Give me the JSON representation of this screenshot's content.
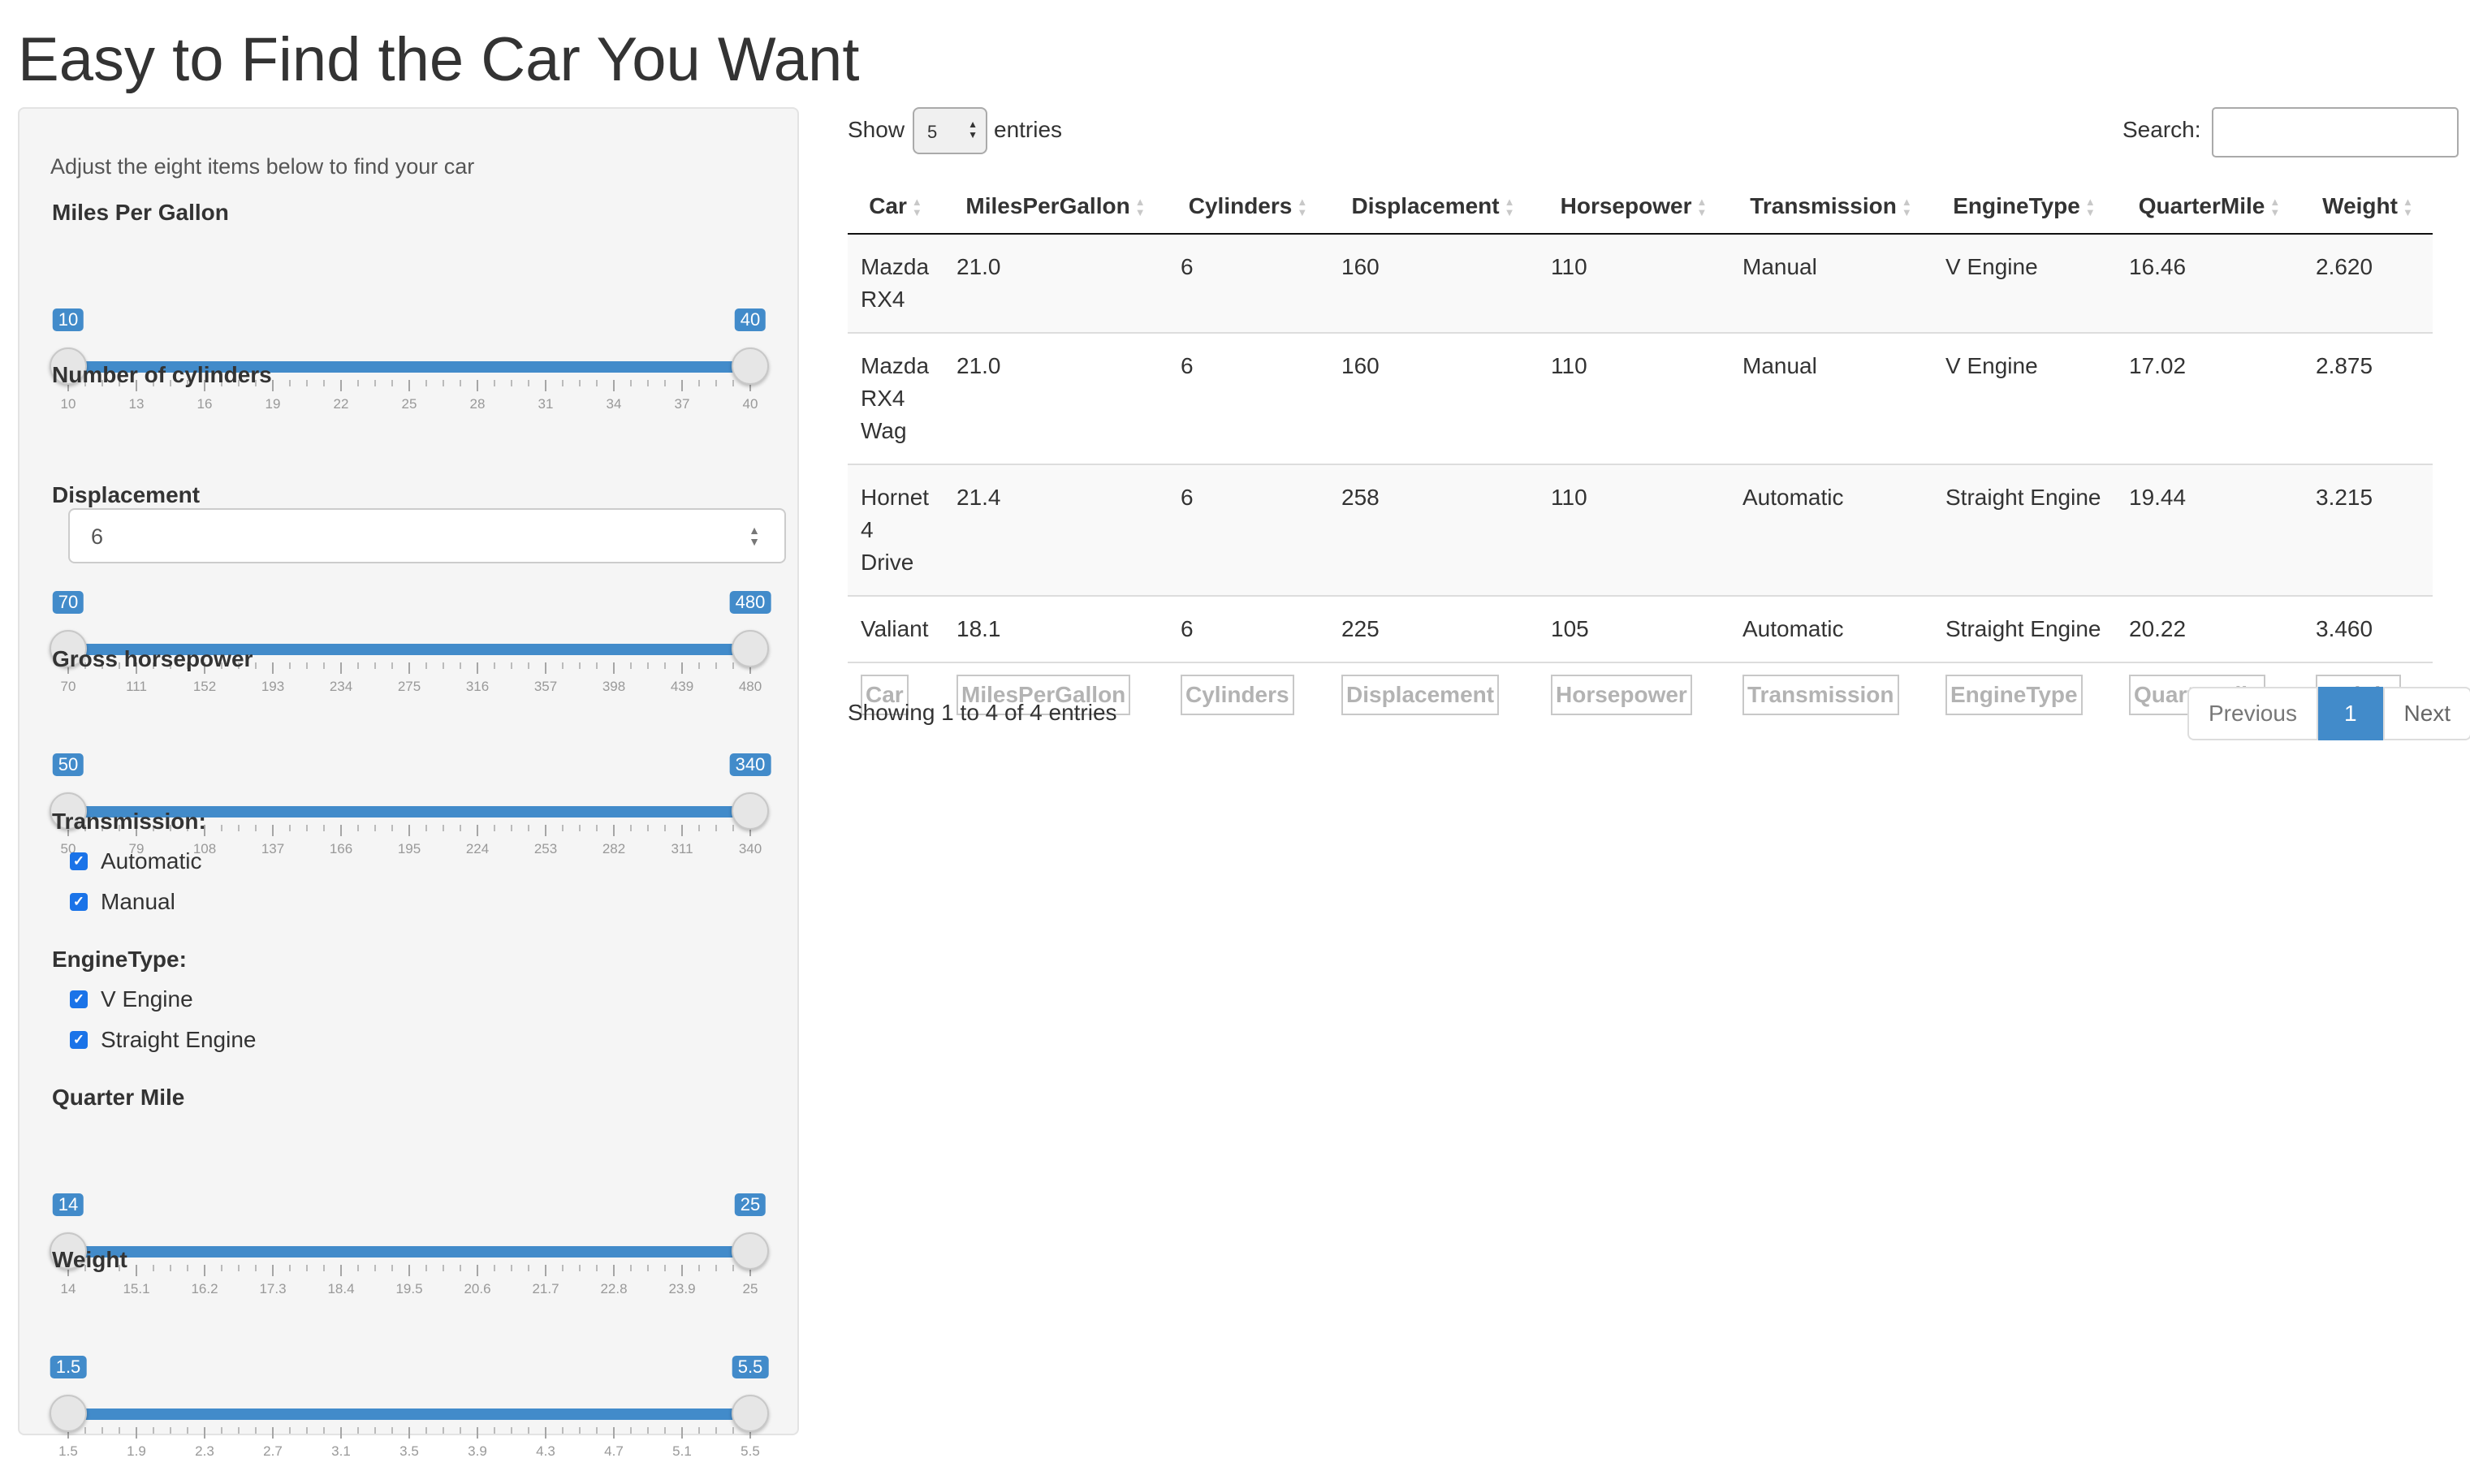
{
  "title": "Easy to Find the Car You Want",
  "sidebar": {
    "intro": "Adjust the eight items below to find your car",
    "mpg": {
      "label": "Miles Per Gallon",
      "min": 10,
      "max": 40,
      "from": 10,
      "to": 40,
      "from_label": "10",
      "to_label": "40",
      "ticks": [
        "10",
        "13",
        "16",
        "19",
        "22",
        "25",
        "28",
        "31",
        "34",
        "37",
        "40"
      ]
    },
    "cylinders": {
      "label": "Number of cylinders",
      "value": "6"
    },
    "displacement": {
      "label": "Displacement",
      "min": 70,
      "max": 480,
      "from": 70,
      "to": 480,
      "from_label": "70",
      "to_label": "480",
      "ticks": [
        "70",
        "111",
        "152",
        "193",
        "234",
        "275",
        "316",
        "357",
        "398",
        "439",
        "480"
      ]
    },
    "horsepower": {
      "label": "Gross horsepower",
      "min": 50,
      "max": 340,
      "from": 50,
      "to": 340,
      "from_label": "50",
      "to_label": "340",
      "ticks": [
        "50",
        "79",
        "108",
        "137",
        "166",
        "195",
        "224",
        "253",
        "282",
        "311",
        "340"
      ]
    },
    "transmission": {
      "label": "Transmission:",
      "options": [
        {
          "label": "Automatic",
          "checked": true
        },
        {
          "label": "Manual",
          "checked": true
        }
      ]
    },
    "enginetype": {
      "label": "EngineType:",
      "options": [
        {
          "label": "V Engine",
          "checked": true
        },
        {
          "label": "Straight Engine",
          "checked": true
        }
      ]
    },
    "quartermile": {
      "label": "Quarter Mile",
      "min": 14,
      "max": 25,
      "from": 14,
      "to": 25,
      "from_label": "14",
      "to_label": "25",
      "ticks": [
        "14",
        "15.1",
        "16.2",
        "17.3",
        "18.4",
        "19.5",
        "20.6",
        "21.7",
        "22.8",
        "23.9",
        "25"
      ]
    },
    "weight": {
      "label": "Weight",
      "min": 1.5,
      "max": 5.5,
      "from": 1.5,
      "to": 5.5,
      "from_label": "1.5",
      "to_label": "5.5",
      "ticks": [
        "1.5",
        "1.9",
        "2.3",
        "2.7",
        "3.1",
        "3.5",
        "3.9",
        "4.3",
        "4.7",
        "5.1",
        "5.5"
      ]
    }
  },
  "table_controls": {
    "show_label": "Show",
    "entries_value": "5",
    "entries_label": "entries",
    "search_label": "Search:",
    "search_value": ""
  },
  "table": {
    "columns": [
      "Car",
      "MilesPerGallon",
      "Cylinders",
      "Displacement",
      "Horsepower",
      "Transmission",
      "EngineType",
      "QuarterMile",
      "Weight"
    ],
    "rows": [
      [
        "Mazda RX4",
        "21.0",
        "6",
        "160",
        "110",
        "Manual",
        "V Engine",
        "16.46",
        "2.620"
      ],
      [
        "Mazda RX4 Wag",
        "21.0",
        "6",
        "160",
        "110",
        "Manual",
        "V Engine",
        "17.02",
        "2.875"
      ],
      [
        "Hornet 4 Drive",
        "21.4",
        "6",
        "258",
        "110",
        "Automatic",
        "Straight Engine",
        "19.44",
        "3.215"
      ],
      [
        "Valiant",
        "18.1",
        "6",
        "225",
        "105",
        "Automatic",
        "Straight Engine",
        "20.22",
        "3.460"
      ]
    ]
  },
  "info": "Showing 1 to 4 of 4 entries",
  "pagination": {
    "previous": "Previous",
    "current": "1",
    "next": "Next"
  },
  "colors": {
    "accent": "#428bca",
    "checkbox": "#1a73e8",
    "sidebar_bg": "#f5f5f5"
  }
}
